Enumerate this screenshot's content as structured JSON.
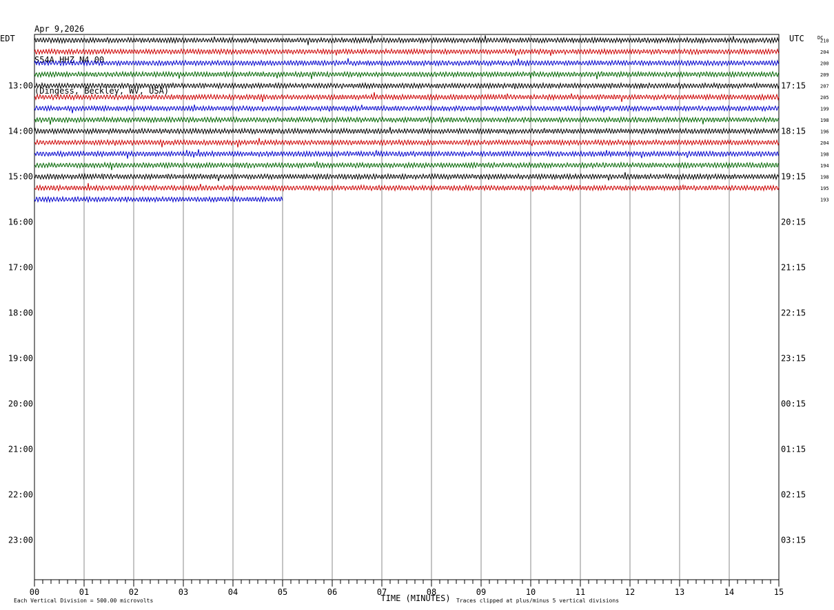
{
  "header": {
    "date": "Apr 9,2026",
    "station": "S54A HHZ N4 00",
    "location": "(Dingess, Beckley, WV, USA)"
  },
  "chart_data": {
    "type": "line",
    "title": "Apr 9,2026",
    "left_zone_label": "EDT",
    "right_zone_label": "UTC",
    "dc_label": "DC",
    "xlabel": "TIME (MINUTES)",
    "x_ticks": [
      "00",
      "01",
      "02",
      "03",
      "04",
      "05",
      "06",
      "07",
      "08",
      "09",
      "10",
      "11",
      "12",
      "13",
      "14",
      "15"
    ],
    "xlim": [
      0,
      15
    ],
    "left_hour_labels": [
      "13:00",
      "14:00",
      "15:00",
      "16:00",
      "17:00",
      "18:00",
      "19:00",
      "20:00",
      "21:00",
      "22:00",
      "23:00"
    ],
    "right_hour_labels": [
      "17:15",
      "18:15",
      "19:15",
      "20:15",
      "21:15",
      "22:15",
      "23:15",
      "00:15",
      "01:15",
      "02:15",
      "03:15"
    ],
    "dc_offsets": [
      210,
      204,
      200,
      209,
      207,
      205,
      199,
      198,
      196,
      204,
      198,
      194,
      198,
      195,
      193
    ],
    "trace_colors": [
      "#000000",
      "#cc0000",
      "#0000cc",
      "#006600"
    ],
    "last_trace_end_minute": 5,
    "footer_left": "Each Vertical Division =  500.00 microvolts",
    "footer_right": "Traces clipped at plus/minus 5 vertical divisions",
    "grid": true
  }
}
